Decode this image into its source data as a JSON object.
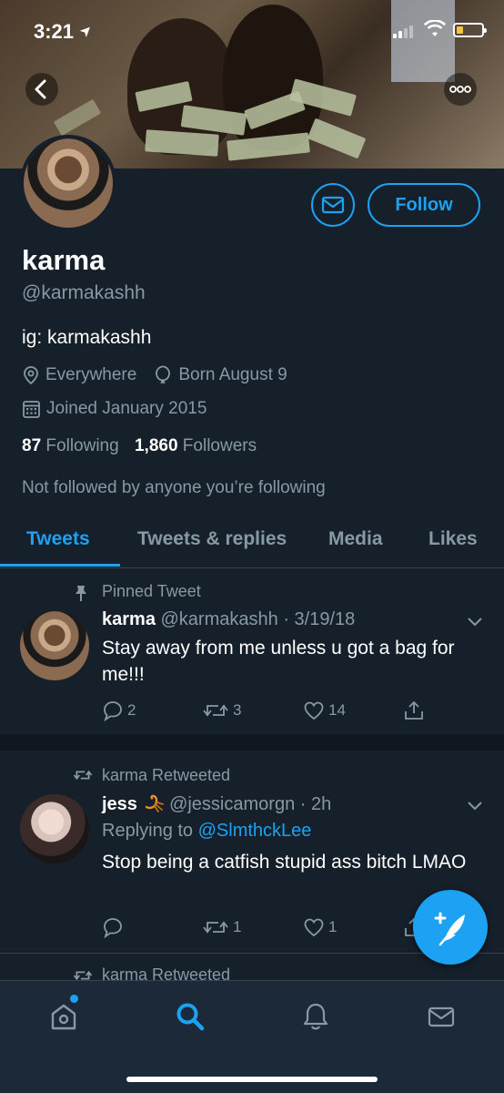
{
  "status_bar": {
    "time": "3:21",
    "location_arrow": "➤"
  },
  "header": {
    "back_icon": "chevron-left-icon",
    "more_icon": "more-horizontal-icon",
    "more_label": "ooo"
  },
  "profile": {
    "name": "karma",
    "handle": "@karmakashh",
    "bio": "ig: karmakashh",
    "location": "Everywhere",
    "birthday": "Born August 9",
    "joined": "Joined January 2015",
    "following_count": "87",
    "following_label": "Following",
    "followers_count": "1,860",
    "followers_label": "Followers",
    "not_followed_text": "Not followed by anyone you’re following",
    "follow_label": "Follow"
  },
  "tabs": [
    {
      "label": "Tweets",
      "active": true
    },
    {
      "label": "Tweets & replies",
      "active": false
    },
    {
      "label": "Media",
      "active": false
    },
    {
      "label": "Likes",
      "active": false
    }
  ],
  "tweets": [
    {
      "context": "Pinned Tweet",
      "name": "karma",
      "handle": "@karmakashh",
      "date": "· 3/19/18",
      "text": "Stay away from me unless u got a bag for me!!!",
      "replies": "2",
      "retweets": "3",
      "likes": "14"
    },
    {
      "context": "karma Retweeted",
      "name": "jess",
      "handle": "@jessicamorgn",
      "date": "· 2h",
      "replying_prefix": "Replying to",
      "replying_to": "@SlmthckLee",
      "text": "Stop being a catfish stupid ass bitch LMAO",
      "replies": "",
      "retweets": "1",
      "likes": "1"
    },
    {
      "context": "karma Retweeted"
    }
  ],
  "colors": {
    "background": "#15202b",
    "accent": "#1da1f2",
    "secondary_text": "#8899a6",
    "bottom_nav": "#1c2938"
  }
}
